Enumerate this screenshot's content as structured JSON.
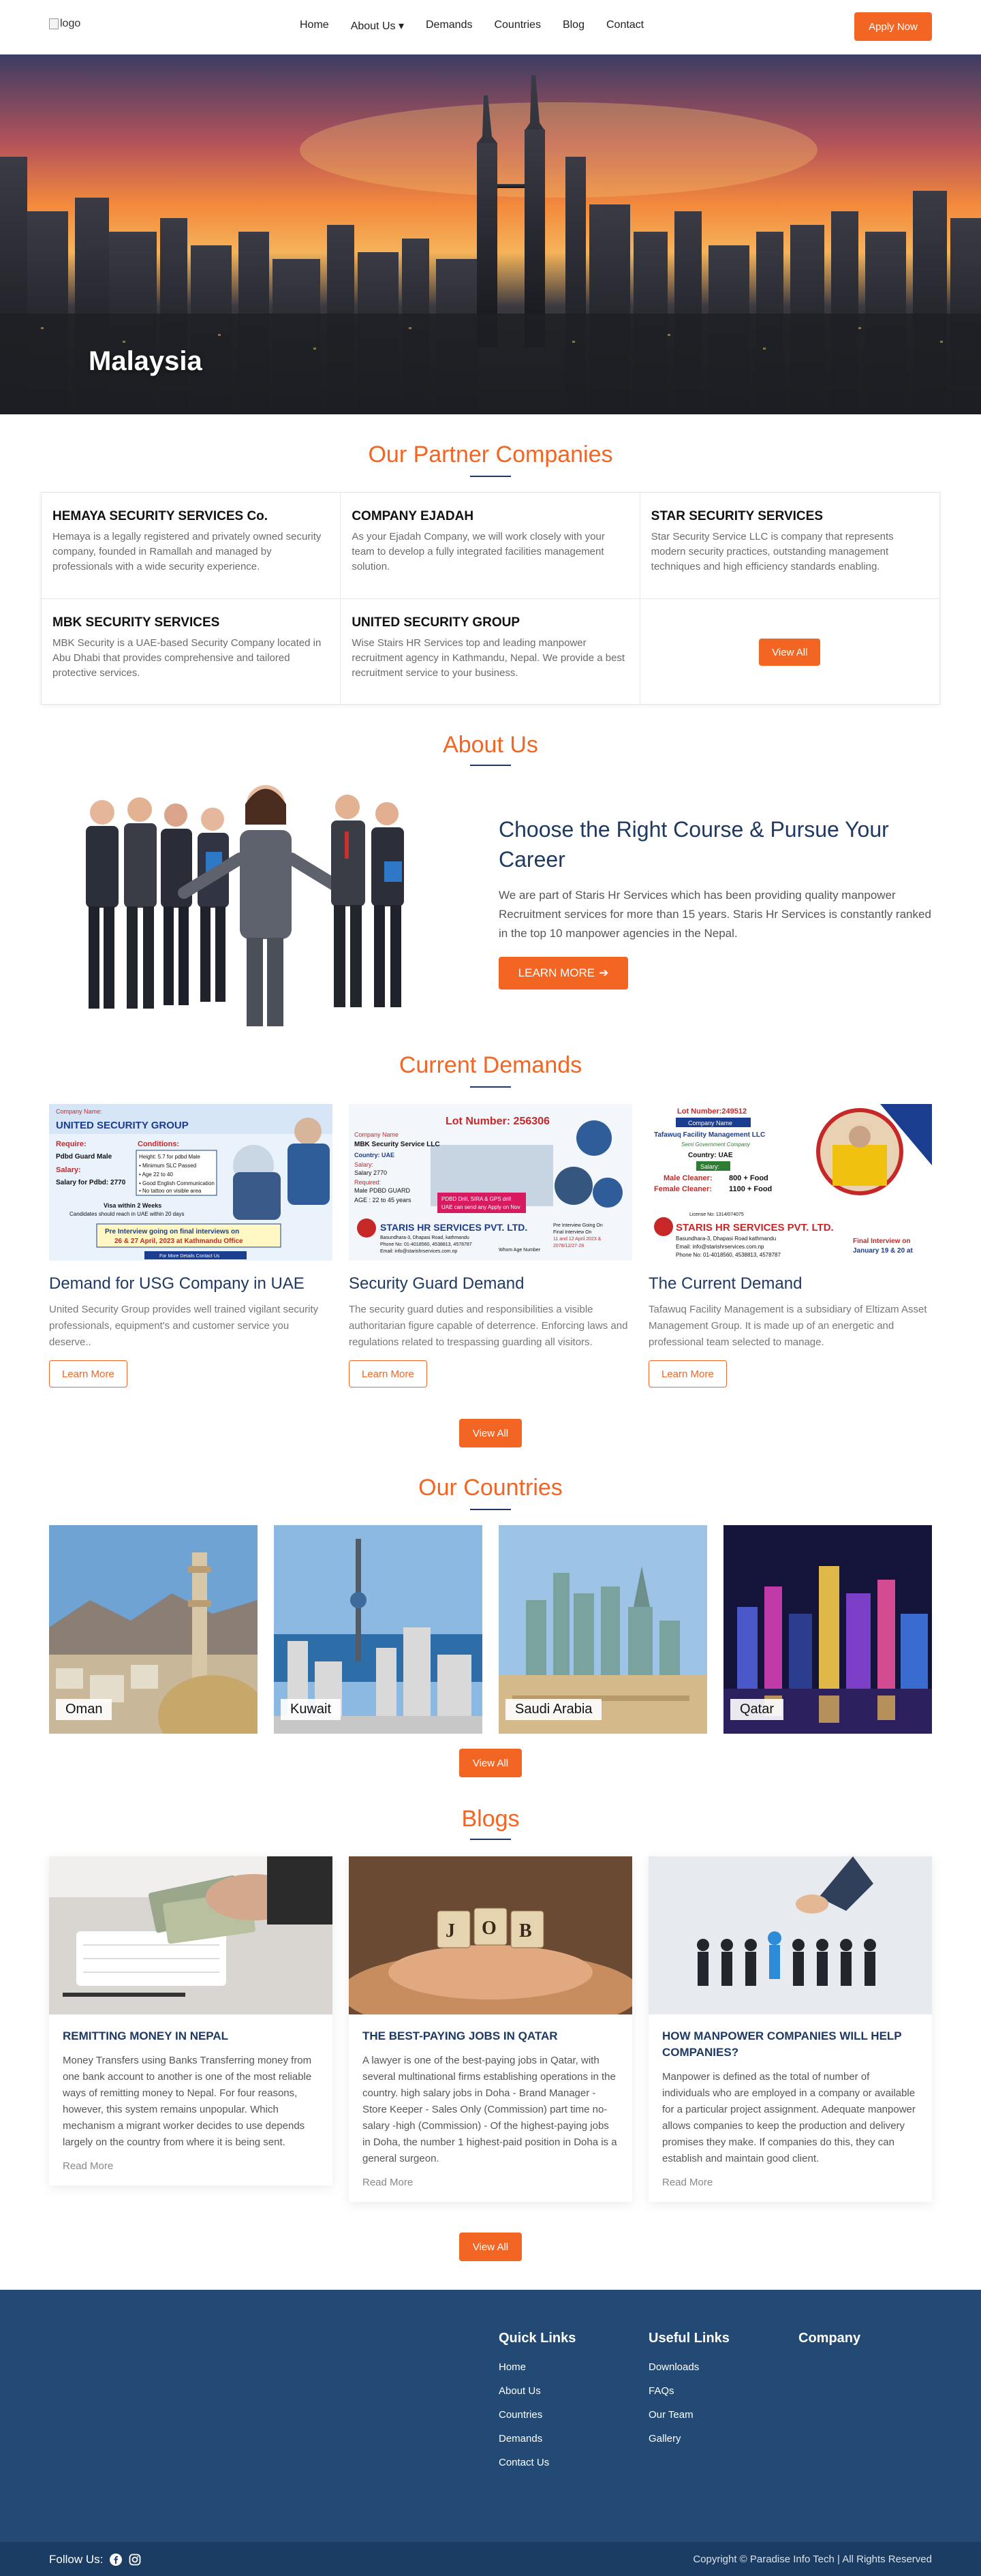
{
  "nav": {
    "logo_alt": "logo",
    "links": [
      {
        "label": "Home"
      },
      {
        "label": "About Us ▾"
      },
      {
        "label": "Demands"
      },
      {
        "label": "Countries"
      },
      {
        "label": "Blog"
      },
      {
        "label": "Contact"
      }
    ],
    "apply_label": "Apply Now"
  },
  "hero": {
    "title": "Malaysia"
  },
  "partners": {
    "heading": "Our Partner Companies",
    "items": [
      {
        "name": "HEMAYA SECURITY SERVICES Co.",
        "desc": "Hemaya is a legally registered and privately owned security company, founded in Ramallah and managed by professionals with a wide security experience."
      },
      {
        "name": "COMPANY EJADAH",
        "desc": "As your Ejadah Company, we will work closely with your team to develop a fully integrated facilities management solution."
      },
      {
        "name": "STAR SECURITY SERVICES",
        "desc": "Star Security Service LLC is company that represents modern security practices, outstanding management techniques and high efficiency standards enabling."
      },
      {
        "name": "MBK SECURITY SERVICES",
        "desc": "MBK Security is a UAE-based Security Company located in Abu Dhabi that provides comprehensive and tailored protective services."
      },
      {
        "name": "UNITED SECURITY GROUP",
        "desc": "Wise Stairs HR Services top and leading manpower recruitment agency in Kathmandu, Nepal. We provide a best recruitment service to your business."
      }
    ],
    "view_all": "View All"
  },
  "about": {
    "heading": "About Us",
    "title": "Choose the Right Course & Pursue Your Career",
    "text": "We are part of Staris Hr Services which has been providing quality manpower Recruitment services for more than 15 years. Staris Hr Services is constantly ranked in the top 10 manpower agencies in the Nepal.",
    "button": "LEARN MORE"
  },
  "demands": {
    "heading": "Current Demands",
    "items": [
      {
        "title": "Demand for USG Company in UAE",
        "desc": "United Security Group provides well trained vigilant security professionals, equipment's and customer service you deserve..",
        "button": "Learn More",
        "poster": {
          "company": "UNITED SECURITY GROUP",
          "tag": "Company Name:",
          "require": "Require:",
          "req_job": "Pdbd Guard Male",
          "salary": "Salary:",
          "salary_val": "Salary for Pdbd: 2770",
          "cond": "Conditions:",
          "c1": "Height: 5.7 for pdbd Male",
          "c2": "• Minimum SLC Passed",
          "c3": "• Age 22 to 40",
          "c4": "• Good English Communication",
          "c5": "• No tattoo on visible area",
          "visa": "Visa within 2 Weeks",
          "visa2": "Candidates should reach in UAE within 20 days",
          "interview": "Pre Interview going on final interviews on",
          "date": "26 & 27 April, 2023 at Kathmandu Office",
          "more": "For More Details Contact Us"
        }
      },
      {
        "title": "Security Guard Demand",
        "desc": "The security guard duties and responsibilities a visible authoritarian figure capable of deterrence. Enforcing laws and regulations related to trespassing guarding all visitors.",
        "button": "Learn More",
        "poster": {
          "lot": "Lot Number: 256306",
          "tag": "Company Name",
          "company": "MBK Security Service LLC",
          "country": "Country: UAE",
          "salary": "Salary:",
          "salary_val": "Salary 2770",
          "req": "Required:",
          "req_val": "Male PDBD GUARD",
          "age": "AGE : 22 to 45 years",
          "promo": "PDBD Drill, SIRA & GPS drill",
          "promo2": "UAE can send any Apply on Nov",
          "agency": "STARIS HR SERVICES PVT. LTD.",
          "addr": "Basundhara-3, Dhapasi Road, kathmandu",
          "phone": "Phone No: 01-4018560, 4538813, 4578787",
          "email": "Email: info@starishrservices.com.np",
          "interview": "Pre Interview Going On",
          "final": "Final Interview On",
          "final_date": "11 and 12 April 2023 &",
          "final_date2": "2078/12/27-28",
          "apply": "Whom Age Number"
        }
      },
      {
        "title": "The Current Demand",
        "desc": "Tafawuq Facility Management is a subsidiary of Eltizam Asset Management Group. It is made up of an energetic and professional team selected to manage.",
        "button": "Learn More",
        "poster": {
          "lot": "Lot Number:249512",
          "tag": "Company Name",
          "company": "Tafawuq Facility Management LLC",
          "gov": "Semi Government Company",
          "country": "Country: UAE",
          "salary": "Salary:",
          "male": "Male Cleaner:",
          "male_val": "800 + Food",
          "female": "Female Cleaner:",
          "female_val": "1100 + Food",
          "license": "License No: 1314/074075",
          "agency": "STARIS HR SERVICES PVT. LTD.",
          "addr": "Basundhara-3, Dhapasi Road kathmandu",
          "email": "Email: info@starishrservices.com.np",
          "phone": "Phone No: 01-4018560, 4538813, 4578787",
          "final": "Final Interview on",
          "final_date": "January 19 & 20 at"
        }
      }
    ],
    "view_all": "View All"
  },
  "countries": {
    "heading": "Our Countries",
    "items": [
      {
        "name": "Oman"
      },
      {
        "name": "Kuwait"
      },
      {
        "name": "Saudi Arabia"
      },
      {
        "name": "Qatar"
      }
    ],
    "view_all": "View All"
  },
  "blogs": {
    "heading": "Blogs",
    "items": [
      {
        "title": "REMITTING MONEY IN NEPAL",
        "text": "Money Transfers using Banks Transferring money from one bank account to another is one of the most reliable ways of remitting money to Nepal. For four reasons, however, this system remains unpopular. Which mechanism a migrant worker decides to use depends largely on the country from where it is being sent.",
        "more": "Read More"
      },
      {
        "title": "THE BEST-PAYING JOBS IN QATAR",
        "text": "A lawyer is one of the best-paying jobs in Qatar, with several multinational firms establishing operations in the country. high salary jobs in Doha - Brand Manager - Store Keeper - Sales Only (Commission) part time no-salary -high (Commission) - Of the highest-paying jobs in Doha, the number 1 highest-paid position in Doha is a general surgeon.",
        "more": "Read More",
        "tile": "JOB"
      },
      {
        "title": "HOW MANPOWER COMPANIES WILL HELP COMPANIES?",
        "text": "Manpower is defined as the total of number of individuals who are employed in a company or available for a particular project assignment. Adequate manpower allows companies to keep the production and delivery promises they make. If companies do this, they can establish and maintain good client.",
        "more": "Read More"
      }
    ],
    "view_all": "View All"
  },
  "footer": {
    "quick_title": "Quick Links",
    "quick": [
      "Home",
      "About Us",
      "Countries",
      "Demands",
      "Contact Us"
    ],
    "useful_title": "Useful Links",
    "useful": [
      "Downloads",
      "FAQs",
      "Our Team",
      "Gallery"
    ],
    "company_title": "Company",
    "follow": "Follow Us:",
    "copyright": "Copyright © Paradise Info Tech | All Rights Reserved"
  },
  "colors": {
    "accent": "#f26522",
    "navy": "#1e3a64",
    "footer": "#224a75"
  }
}
